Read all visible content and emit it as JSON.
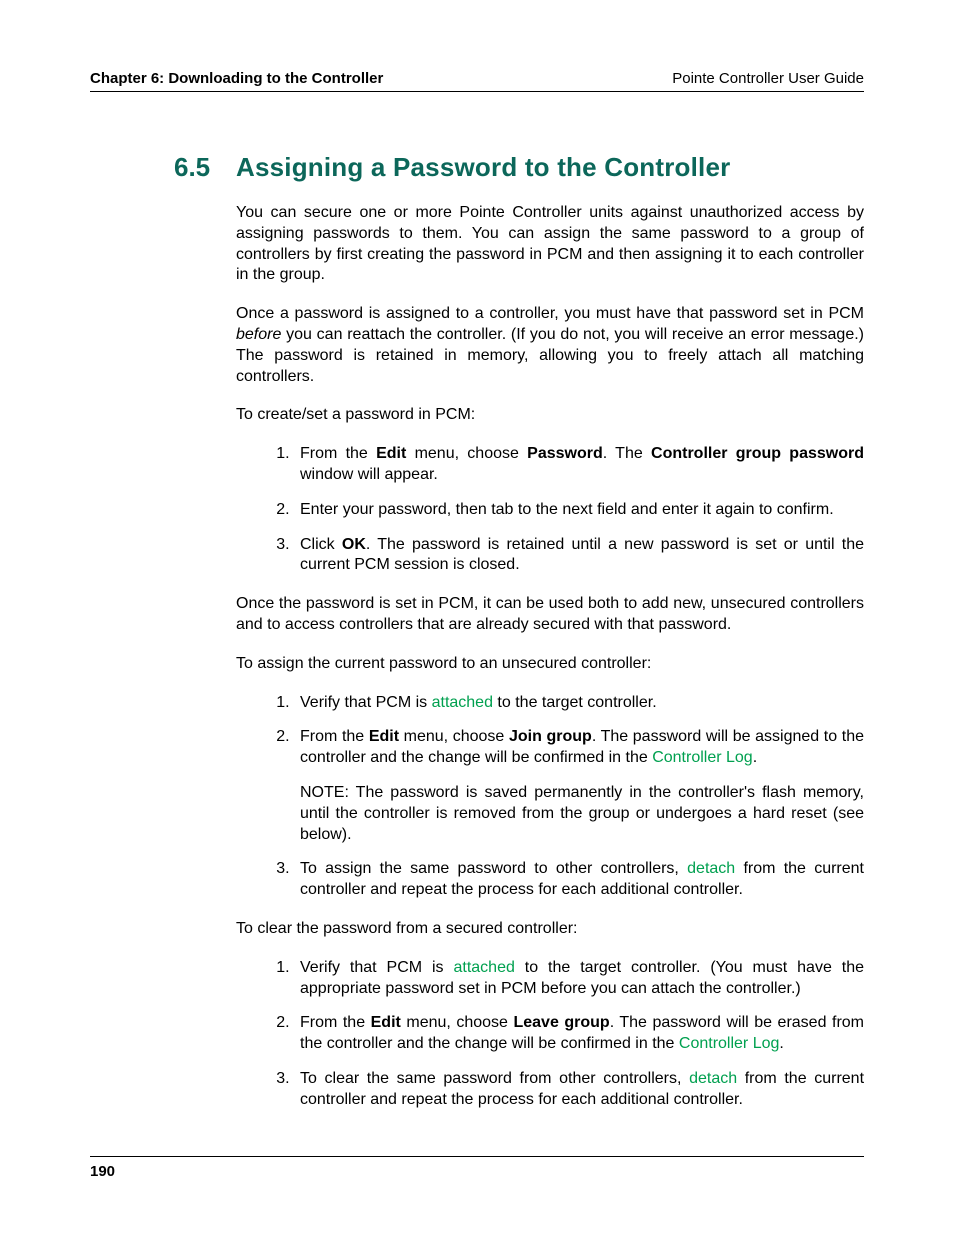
{
  "header": {
    "chapter": "Chapter 6: Downloading to the Controller",
    "guide": "Pointe Controller User Guide"
  },
  "section": {
    "number": "6.5",
    "title": "Assigning a Password to the Controller"
  },
  "para1": "You can secure one or more Pointe Controller units against unauthorized access by assigning passwords to them. You can assign the same password to a group of controllers by first creating the password in PCM and then assigning it to each controller in the group.",
  "para2_a": "Once a password is assigned to a controller, you must have that password set in PCM ",
  "para2_before": "before",
  "para2_b": " you can reattach the controller. (If you do not, you will receive an error message.) The password is retained in memory, allowing you to freely attach all matching controllers.",
  "para3": "To create/set a password in PCM:",
  "listA": {
    "l1_a": "From the ",
    "l1_b": "Edit",
    "l1_c": " menu, choose ",
    "l1_d": "Password",
    "l1_e": ". The ",
    "l1_f": "Controller group password",
    "l1_g": " window will appear.",
    "l2": "Enter your password, then tab to the next field and enter it again to confirm.",
    "l3_a": "Click ",
    "l3_b": "OK",
    "l3_c": ". The password is retained until a new password is set or until the current PCM session is closed."
  },
  "para4": "Once the password is set in PCM, it can be used both to add new, unsecured controllers and to access controllers that are already secured with that password.",
  "para5": "To assign the current password to an unsecured controller:",
  "listB": {
    "l1_a": "Verify that PCM is ",
    "l1_b": "attached",
    "l1_c": " to the target controller.",
    "l2_a": "From the ",
    "l2_b": "Edit",
    "l2_c": " menu, choose ",
    "l2_d": "Join group",
    "l2_e": ". The password will be assigned to the controller and the change will be confirmed in the ",
    "l2_f": "Controller Log",
    "l2_g": ".",
    "note": "NOTE: The password is saved permanently in the controller's flash memory, until the controller is removed from the group or undergoes a hard reset (see below).",
    "l3_a": "To assign the same password to other controllers, ",
    "l3_b": "detach",
    "l3_c": " from the current controller and repeat the process for each additional controller."
  },
  "para6": "To clear the password from a secured controller:",
  "listC": {
    "l1_a": "Verify that PCM is ",
    "l1_b": "attached",
    "l1_c": " to the target controller. (You must have the appropriate password set in PCM before you can attach the controller.)",
    "l2_a": "From the ",
    "l2_b": "Edit",
    "l2_c": " menu, choose ",
    "l2_d": "Leave group",
    "l2_e": ". The password will be erased from the controller and the change will be confirmed in the ",
    "l2_f": "Controller Log",
    "l2_g": ".",
    "l3_a": "To clear the same password from other controllers, ",
    "l3_b": "detach",
    "l3_c": " from the current controller and repeat the process for each additional controller."
  },
  "footer": {
    "page": "190"
  }
}
